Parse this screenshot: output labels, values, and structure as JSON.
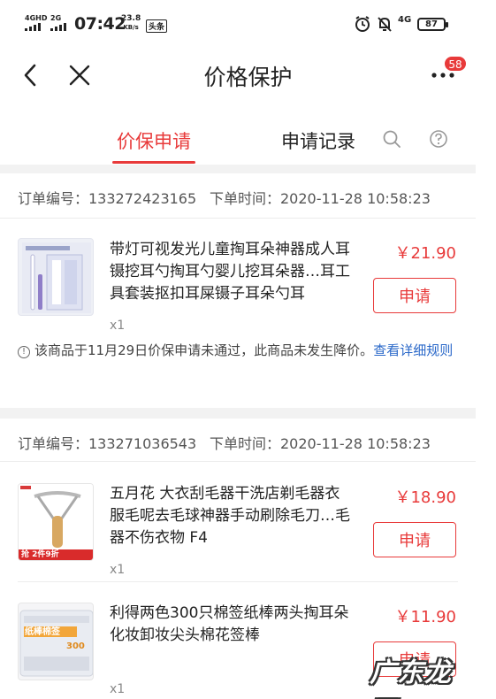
{
  "status_bar": {
    "signal1": "4GHD",
    "signal2": "2G",
    "time": "07:42",
    "speed_value": "23.8",
    "speed_unit": "KB/s",
    "app_tag": "头条",
    "net_type": "4G",
    "battery": "87"
  },
  "header": {
    "title": "价格保护",
    "badge_count": "58"
  },
  "tabs": [
    {
      "label": "价保申请",
      "active": true
    },
    {
      "label": "申请记录",
      "active": false
    }
  ],
  "orders": [
    {
      "order_label": "订单编号：133272423165",
      "time_label": "下单时间：2020-11-28 10:58:23",
      "items": [
        {
          "title": "带灯可视发光儿童掏耳朵神器成人耳镊挖耳勺掏耳勺婴儿挖耳朵器…耳工具套装抠扣耳屎镊子耳朵勺耳",
          "price": "￥21.90",
          "qty": "x1",
          "button": "申请"
        }
      ],
      "notice": {
        "text": "该商品于11月29日价保申请未通过，此商品未发生降价。",
        "link": "查看详细规则"
      }
    },
    {
      "order_label": "订单编号：133271036543",
      "time_label": "下单时间：2020-11-28 10:58:23",
      "items": [
        {
          "title": "五月花 大衣刮毛器干洗店剃毛器衣服毛呢去毛球神器手动刷除毛刀…毛器不伤衣物 F4",
          "price": "￥18.90",
          "qty": "x1",
          "button": "申请",
          "promo": "抢 2件9折"
        },
        {
          "title": "利得两色300只棉签纸棒两头掏耳朵化妆卸妆尖头棉花签棒",
          "price": "￥11.90",
          "qty": "x1",
          "button": "申请",
          "pkg_text": "纸棒棉签",
          "pkg_count": "300"
        }
      ]
    }
  ],
  "watermark": "广东龙网",
  "colors": {
    "accent": "#e83a3a",
    "link": "#2a68c9"
  }
}
